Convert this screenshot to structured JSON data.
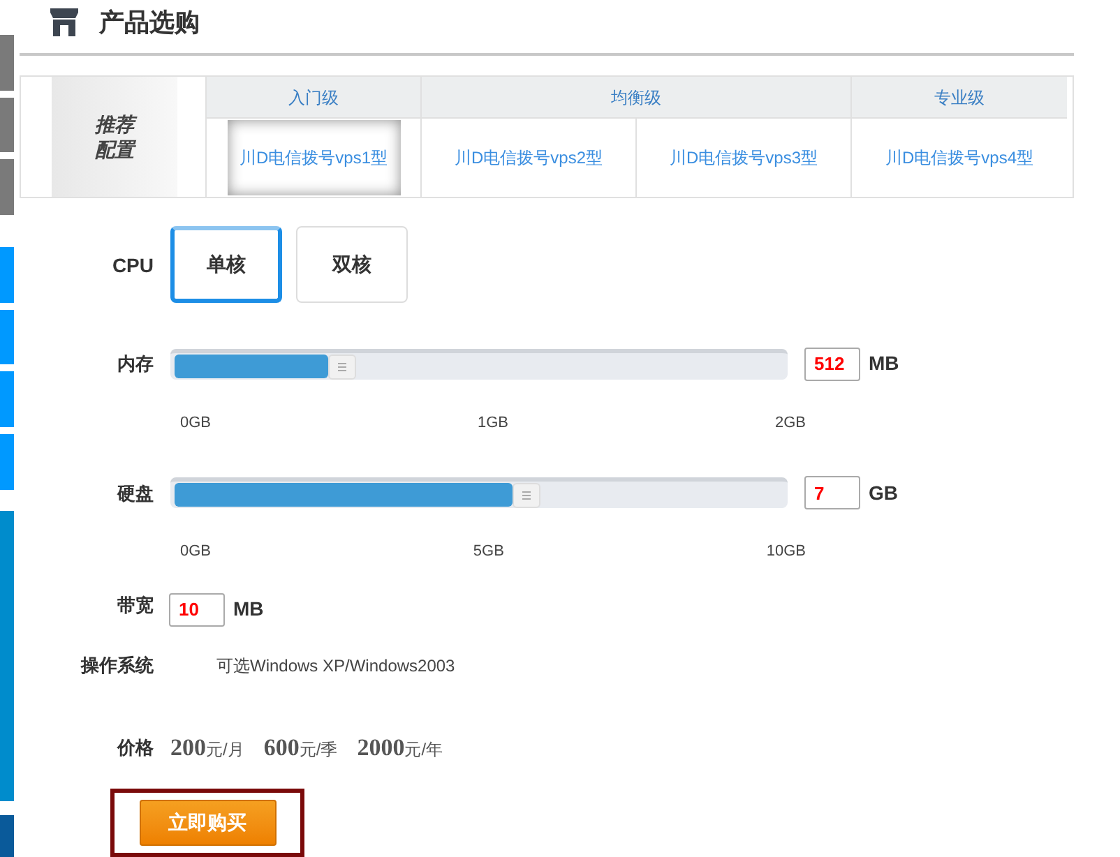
{
  "header": {
    "title": "产品选购"
  },
  "recommend": {
    "label": "推荐配置",
    "tiers": [
      {
        "name": "入门级",
        "plans": [
          {
            "label": "川D电信拨号vps1型",
            "selected": true
          }
        ]
      },
      {
        "name": "均衡级",
        "plans": [
          {
            "label": "川D电信拨号vps2型",
            "selected": false
          },
          {
            "label": "川D电信拨号vps3型",
            "selected": false
          }
        ]
      },
      {
        "name": "专业级",
        "plans": [
          {
            "label": "川D电信拨号vps4型",
            "selected": false
          }
        ]
      }
    ]
  },
  "cpu": {
    "label": "CPU",
    "options": [
      {
        "label": "单核",
        "selected": true
      },
      {
        "label": "双核",
        "selected": false
      }
    ]
  },
  "sliders": [
    {
      "label": "内存",
      "level": 0.25,
      "value": "512",
      "unit": "MB",
      "ticks": [
        "0GB",
        "1GB",
        "2GB"
      ]
    },
    {
      "label": "硬盘",
      "level": 0.55,
      "value": "7",
      "unit": "GB",
      "ticks": [
        "0GB",
        "5GB",
        "10GB"
      ]
    }
  ],
  "bandwidth": {
    "label": "带宽",
    "value": "10",
    "unit": "MB"
  },
  "os": {
    "label": "操作系统",
    "value": "可选Windows XP/Windows2003"
  },
  "price": {
    "label": "价格",
    "items": [
      {
        "amount": "200",
        "unit": "元/月"
      },
      {
        "amount": "600",
        "unit": "元/季"
      },
      {
        "amount": "2000",
        "unit": "元/年"
      }
    ]
  },
  "buy_button": "立即购买"
}
